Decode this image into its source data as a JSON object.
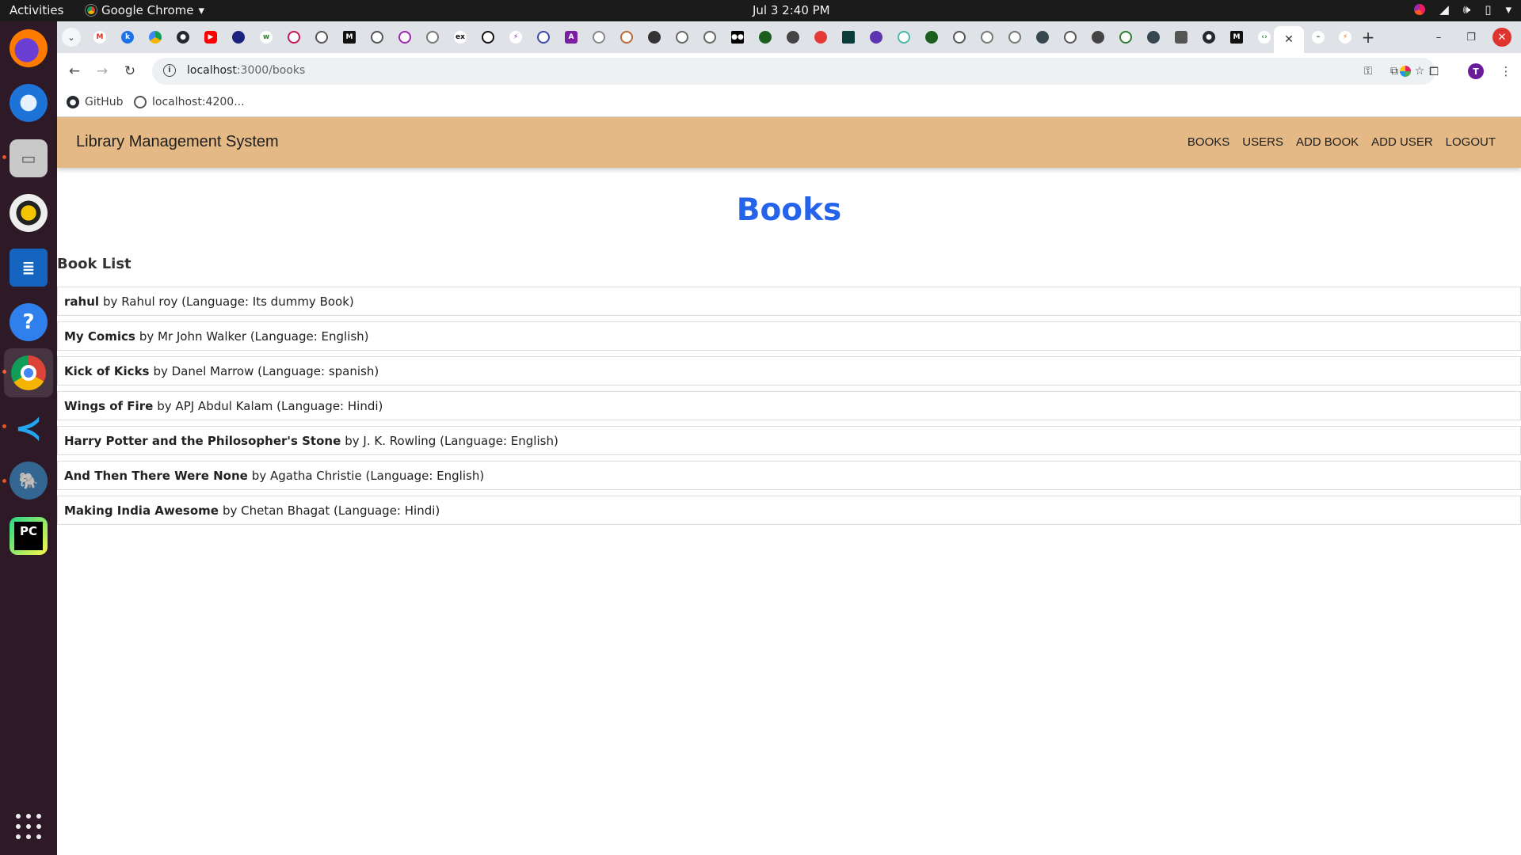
{
  "os": {
    "activities_label": "Activities",
    "app_name": "Google Chrome",
    "clock": "Jul 3  2:40 PM"
  },
  "browser": {
    "url_host": "localhost",
    "url_path": ":3000/books",
    "profile_initial": "T",
    "tab_close_glyph": "✕",
    "bookmarks": [
      {
        "label": "GitHub",
        "icon": "github-icon"
      },
      {
        "label": "localhost:4200...",
        "icon": "globe-icon"
      }
    ]
  },
  "app": {
    "brand": "Library Management System",
    "nav": [
      "BOOKS",
      "USERS",
      "ADD BOOK",
      "ADD USER",
      "LOGOUT"
    ],
    "page_title": "Books",
    "section_title": "Book List",
    "books": [
      {
        "title": "rahul",
        "rest": "by Rahul roy (Language: Its dummy Book)"
      },
      {
        "title": "My Comics",
        "rest": "by Mr John Walker (Language: English)"
      },
      {
        "title": "Kick of Kicks",
        "rest": "by Danel Marrow (Language: spanish)"
      },
      {
        "title": "Wings of Fire",
        "rest": "by APJ Abdul Kalam (Language: Hindi)"
      },
      {
        "title": "Harry Potter and the Philosopher's Stone",
        "rest": "by J. K. Rowling (Language: English)"
      },
      {
        "title": "And Then There Were None",
        "rest": "by Agatha Christie (Language: English)"
      },
      {
        "title": "Making India Awesome",
        "rest": "by Chetan Bhagat (Language: Hindi)"
      }
    ]
  },
  "colors": {
    "navbar_bg": "#e5b985",
    "title_blue": "#2563eb",
    "dock_bg": "#2d1a26"
  }
}
